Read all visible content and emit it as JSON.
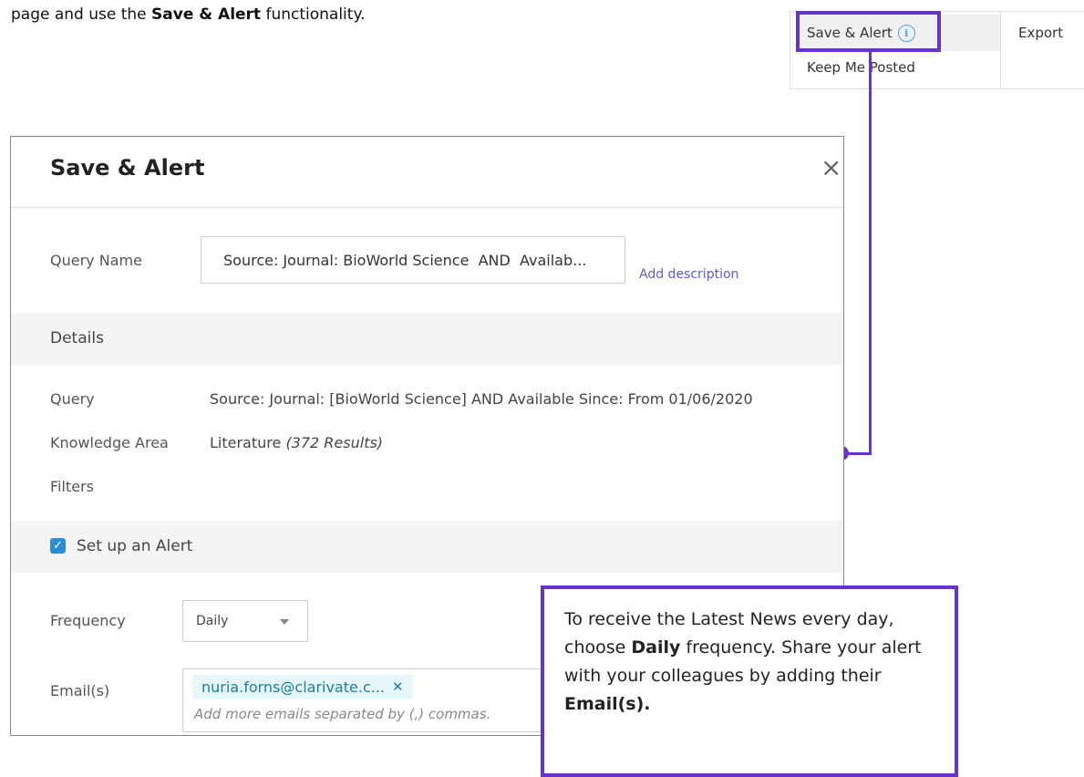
{
  "intro": {
    "prefix": "page and use the ",
    "bold": "Save & Alert",
    "suffix": " functionality."
  },
  "toolbar": {
    "save_alert_label": "Save & Alert",
    "keep_posted_label": "Keep Me Posted",
    "export_label": "Export"
  },
  "dialog": {
    "title": "Save & Alert",
    "query_name_label": "Query Name",
    "query_name_value": "Source: Journal: BioWorld Science  AND  Availab...",
    "add_description": "Add description",
    "details_heading": "Details",
    "query_label": "Query",
    "query_value": "Source: Journal: [BioWorld Science] AND Available Since: From 01/06/2020",
    "knowledge_area_label": "Knowledge Area",
    "knowledge_area_value": "Literature",
    "knowledge_area_results": "(372 Results)",
    "filters_label": "Filters",
    "alert_label": "Set up an Alert",
    "alert_checked": true,
    "frequency_label": "Frequency",
    "frequency_value": "Daily",
    "emails_label": "Email(s)",
    "email_chip": "nuria.forns@clarivate.c...",
    "email_placeholder": "Add more emails separated by (,) commas."
  },
  "callout": {
    "part1": "To receive the Latest News every day, choose ",
    "bold1": "Daily",
    "part2": " frequency. Share your alert with your colleagues by adding their ",
    "bold2": "Email(s)."
  },
  "colors": {
    "highlight": "#6633cc",
    "checkbox": "#2a8dd6",
    "chip_bg": "#e6f7fa",
    "link": "#5b5bd6"
  }
}
